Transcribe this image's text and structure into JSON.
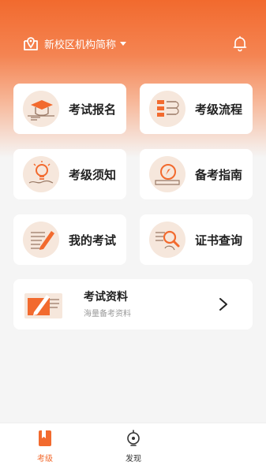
{
  "header": {
    "campus": "新校区机构简称"
  },
  "grid": [
    {
      "label": "考试报名"
    },
    {
      "label": "考级流程"
    },
    {
      "label": "考级须知"
    },
    {
      "label": "备考指南"
    },
    {
      "label": "我的考试"
    },
    {
      "label": "证书查询"
    }
  ],
  "materials": {
    "title": "考试资料",
    "subtitle": "海量备考资料"
  },
  "tabbar": {
    "items": [
      {
        "label": "考级",
        "active": true
      },
      {
        "label": "发现",
        "active": false
      }
    ]
  },
  "colors": {
    "accent": "#f26a2e",
    "icon_bg": "#f6e7dc"
  }
}
